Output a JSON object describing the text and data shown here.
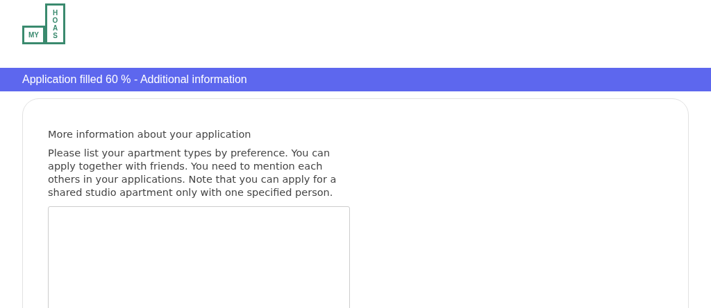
{
  "logo": {
    "left": "MY",
    "right": "HOAS"
  },
  "progress_bar": {
    "text": "Application filled 60 % - Additional information"
  },
  "form": {
    "heading": "More information about your application",
    "description": "Please list your apartment types by preference. You can apply together with friends. You need to mention each others in your applications. Note that you can apply for a shared studio apartment only with one specified person."
  }
}
